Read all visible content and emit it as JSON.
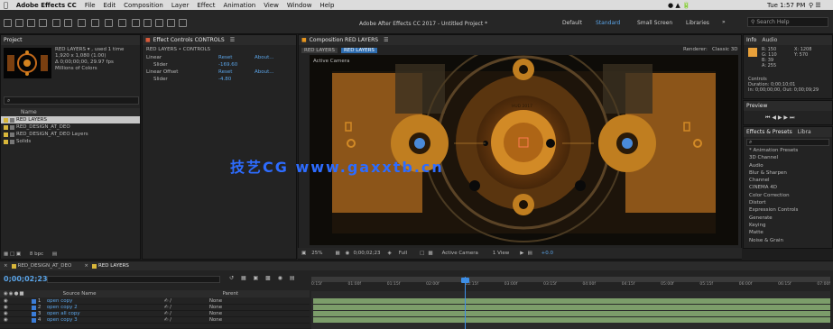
{
  "menubar": {
    "items": [
      "Adobe Effects CC",
      "File",
      "Edit",
      "Composition",
      "Layer",
      "Effect",
      "Animation",
      "View",
      "Window",
      "Help"
    ],
    "window_title": "Adobe After Effects CC 2017 - Untitled Project *",
    "clock": "Tue 1:57 PM"
  },
  "workspaces": [
    "Default",
    "Standard",
    "Small Screen",
    "Libraries"
  ],
  "search_help": "Search Help",
  "project_panel": {
    "title": "Project",
    "thumb_name": "RED LAYERS ▾ , used 1 time",
    "thumb_info1": "1,920 x 1,080 (1.00)",
    "thumb_info2": "Δ 0;00;00;00, 29.97 fps",
    "thumb_info3": "Millions of Colors",
    "search_placeholder": "⌕",
    "column_name": "Name",
    "items": [
      "RED LAYERS",
      "RED_DESIGN_AT_DEO",
      "RED_DESIGN_AT_DEO Layers",
      "Solids"
    ],
    "bpc": "8 bpc"
  },
  "effect_controls": {
    "title": "Effect Controls CONTROLS",
    "path": "RED LAYERS • CONTROLS",
    "rows": [
      {
        "name": "Linear",
        "col1": "Reset",
        "col2": "About..."
      },
      {
        "name": "Slider",
        "col1": "-169.60",
        "col2": ""
      },
      {
        "name": "Linear Offset",
        "col1": "Reset",
        "col2": "About..."
      },
      {
        "name": "Slider",
        "col1": "-4.80",
        "col2": ""
      }
    ]
  },
  "composition": {
    "tab": "Composition RED LAYERS",
    "sub_tab1": "RED LAYERS",
    "sub_tab2": "RED LAYERS",
    "renderer_label": "Renderer:",
    "renderer_value": "Classic 3D",
    "camera_label": "Active Camera",
    "center_text": "HUD 2017",
    "watermark": "技艺CG  www.gaxxtb.cn",
    "footer": {
      "zoom": "25%",
      "timecode": "0;00;02;23",
      "resolution": "Full",
      "camera": "Active Camera",
      "views": "1 View",
      "exposure": "+0.0"
    }
  },
  "info_panel": {
    "tabs": [
      "Info",
      "Audio"
    ],
    "r": "R: 150",
    "g": "G: 110",
    "b": "B: 39",
    "a": "A: 255",
    "x": "X: 1208",
    "y": "Y: 570",
    "lines": [
      "Controls",
      "Duration: 0;00;10;01",
      "In: 0;00;00;00, Out: 0;00;09;29"
    ],
    "swatch": "#e8a03a"
  },
  "preview_panel": {
    "title": "Preview"
  },
  "effects_presets": {
    "tabs": [
      "Effects & Presets",
      "Libra"
    ],
    "search": "⌕",
    "items": [
      "* Animation Presets",
      "3D Channel",
      "Audio",
      "Blur & Sharpen",
      "Channel",
      "CINEMA 4D",
      "Color Correction",
      "Distort",
      "Expression Controls",
      "Generate",
      "Keying",
      "Matte",
      "Noise & Grain"
    ]
  },
  "timeline": {
    "tabs": [
      "RED_DESIGN_AT_DEO",
      "RED LAYERS"
    ],
    "timecode": "0;00;02;23",
    "column_source": "Source Name",
    "column_parent": "Parent",
    "ruler": [
      "0:15f",
      "01:00f",
      "01:15f",
      "02:00f",
      "02:15f",
      "03:00f",
      "03:15f",
      "04:00f",
      "04:15f",
      "05:00f",
      "05:15f",
      "06:00f",
      "06:15f",
      "07:00f"
    ],
    "layers": [
      {
        "num": "1",
        "name": "open copy",
        "parent": "None",
        "color": "#3b7dd8"
      },
      {
        "num": "2",
        "name": "open copy 2",
        "parent": "None",
        "color": "#3b7dd8"
      },
      {
        "num": "3",
        "name": "open all copy",
        "parent": "None",
        "color": "#3b7dd8"
      },
      {
        "num": "4",
        "name": "open copy 3",
        "parent": "None",
        "color": "#3b7dd8"
      }
    ]
  },
  "colors": {
    "accent_blue": "#5aa3e6",
    "orange": "#e8961e",
    "layer_bar": "#7c9d6a",
    "playhead": "#3d8ee6"
  }
}
